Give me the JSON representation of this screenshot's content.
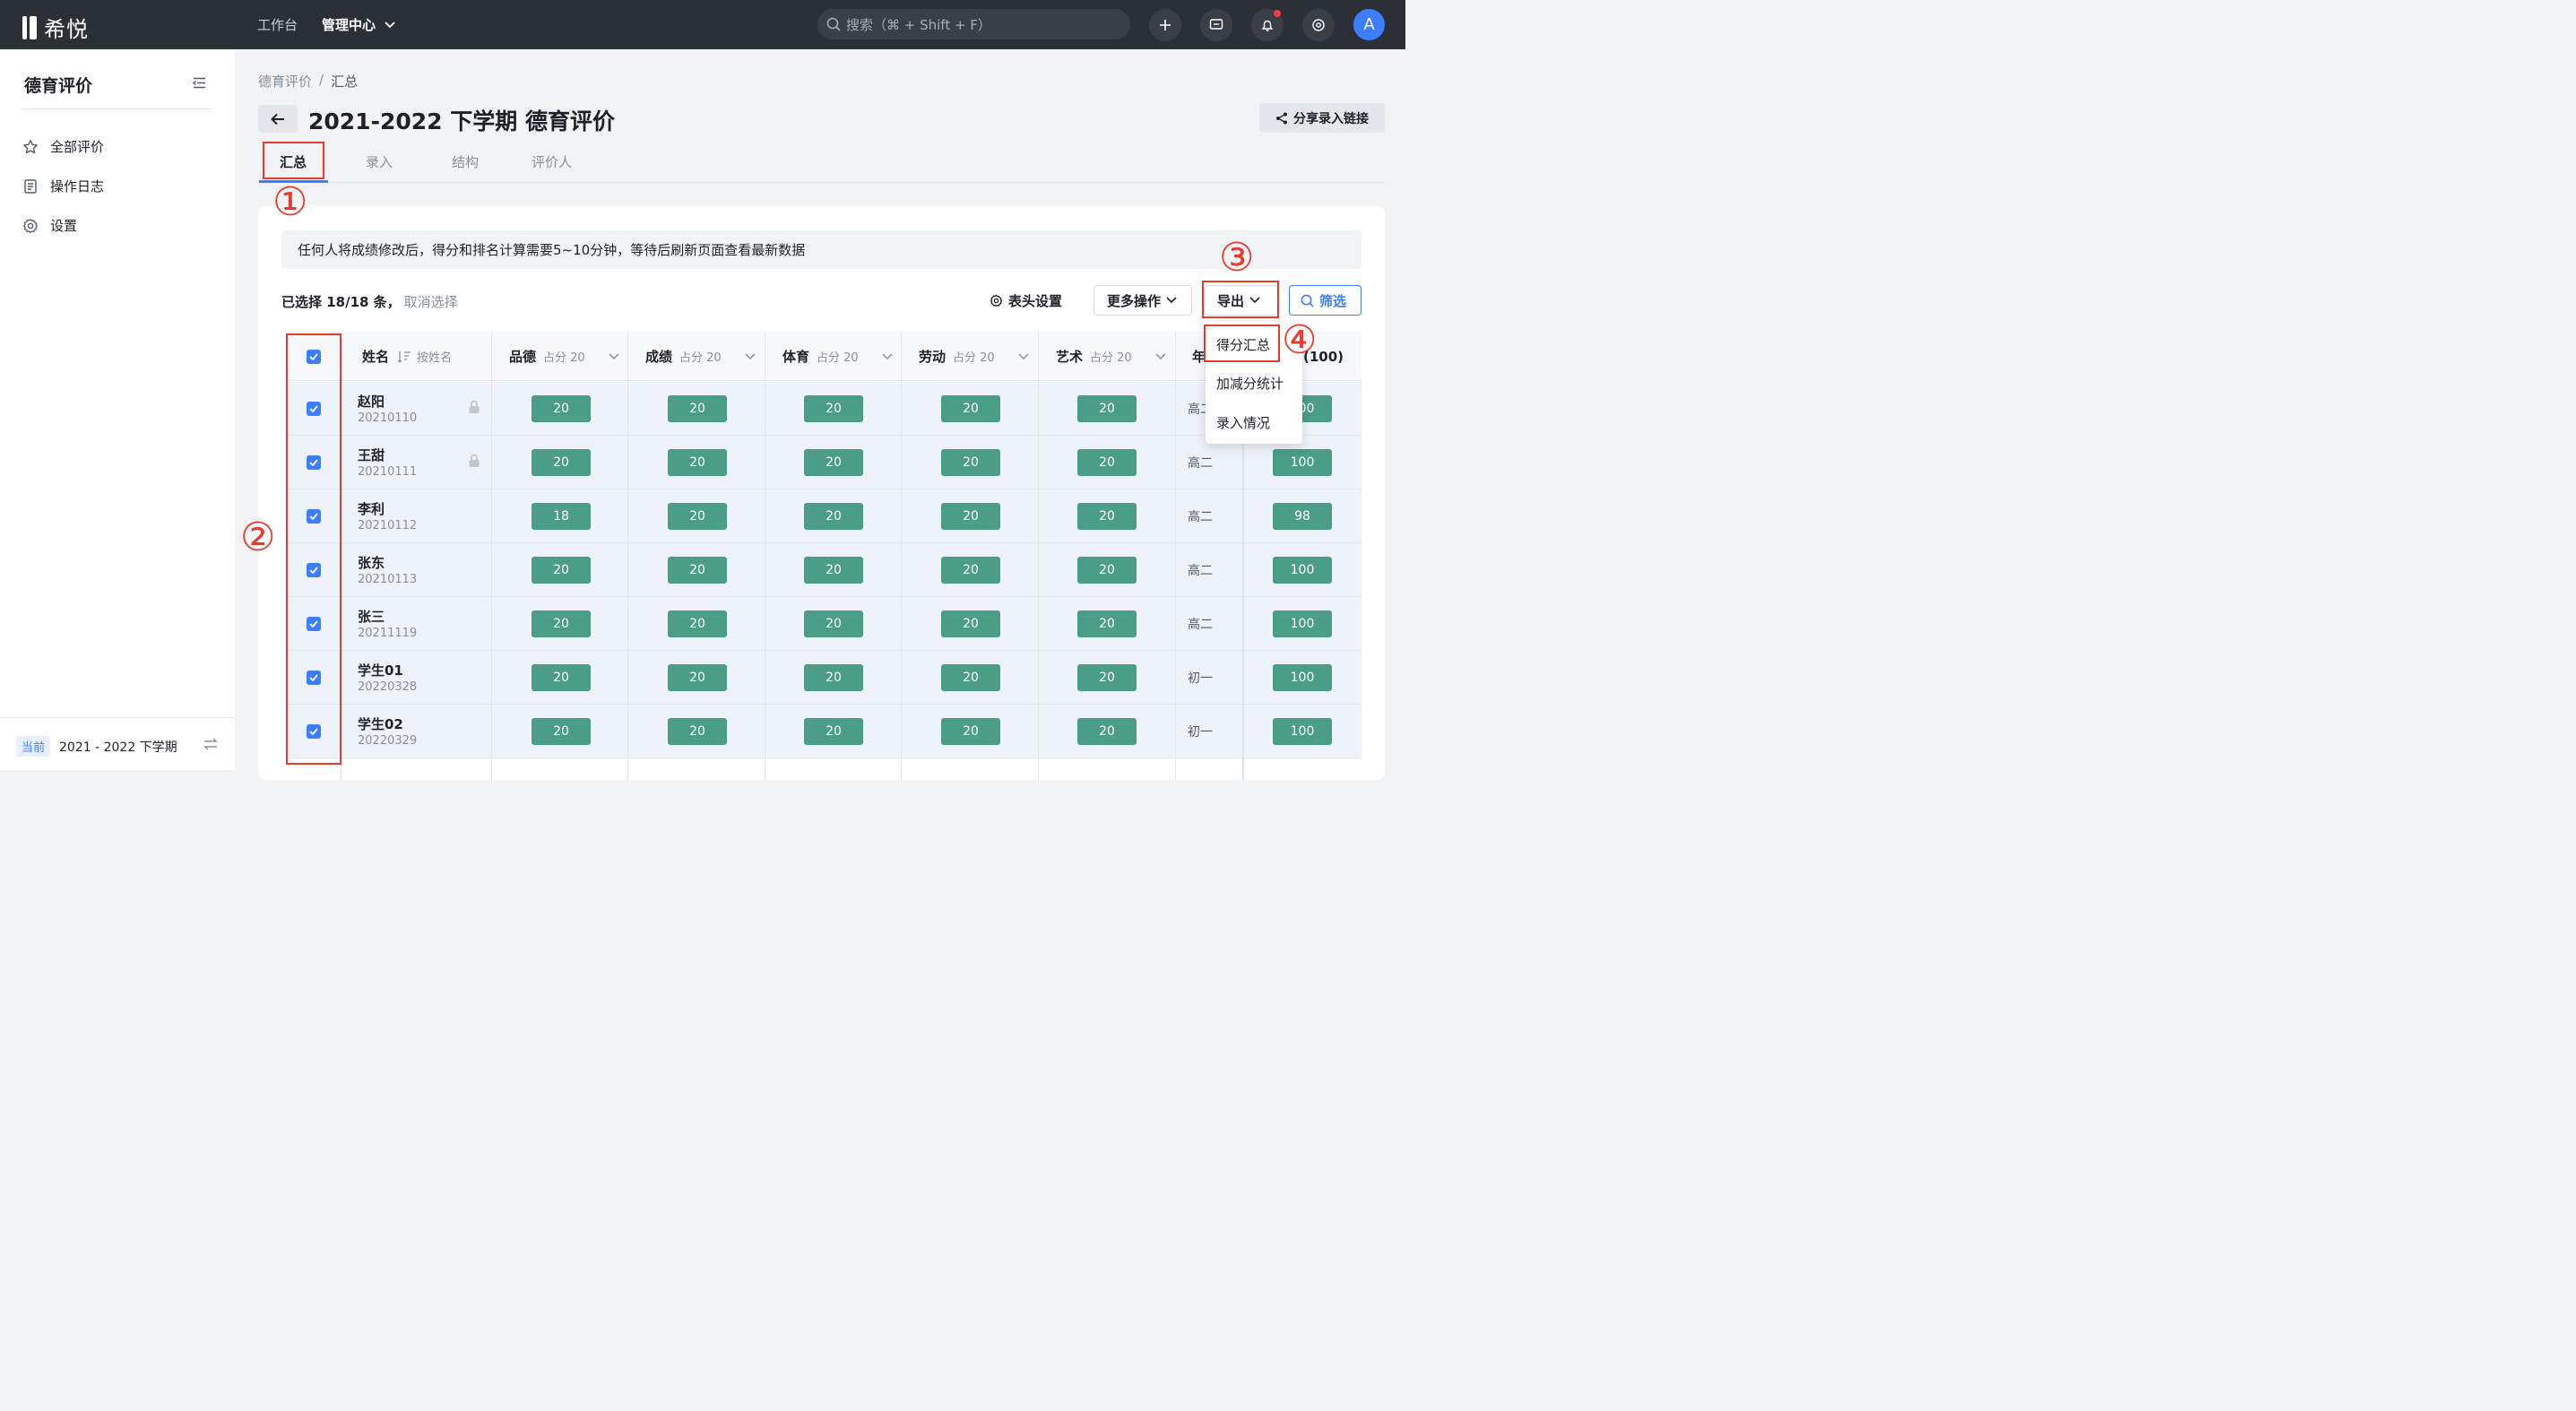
{
  "app": {
    "logo_text": "希悦"
  },
  "topnav": {
    "workbench": "工作台",
    "admin_center": "管理中心"
  },
  "search": {
    "placeholder": "搜索（⌘ + Shift + F）"
  },
  "user": {
    "avatar_letter": "A"
  },
  "sidebar": {
    "title": "德育评价",
    "items": [
      {
        "label": "全部评价",
        "icon": "star-icon"
      },
      {
        "label": "操作日志",
        "icon": "document-icon"
      },
      {
        "label": "设置",
        "icon": "gear-icon"
      }
    ],
    "term_badge": "当前",
    "term_label": "2021 - 2022 下学期"
  },
  "breadcrumb": {
    "parent": "德育评价",
    "separator": "/",
    "current": "汇总"
  },
  "page": {
    "title": "2021-2022 下学期 德育评价",
    "share_button": "分享录入链接"
  },
  "tabs": [
    {
      "label": "汇总",
      "active": true
    },
    {
      "label": "录入",
      "active": false
    },
    {
      "label": "结构",
      "active": false
    },
    {
      "label": "评价人",
      "active": false
    }
  ],
  "notice": "任何人将成绩修改后，得分和排名计算需要5~10分钟，等待后刷新页面查看最新数据",
  "toolbar": {
    "selected": "已选择 18/18 条，",
    "cancel": "取消选择",
    "header_settings": "表头设置",
    "more_actions": "更多操作",
    "export": "导出",
    "filter": "筛选"
  },
  "export_menu": [
    "得分汇总",
    "加减分统计",
    "录入情况"
  ],
  "table": {
    "name_header": "姓名",
    "sort_label": "按姓名",
    "columns": [
      {
        "label": "品德",
        "weight": "占分 20"
      },
      {
        "label": "成绩",
        "weight": "占分 20"
      },
      {
        "label": "体育",
        "weight": "占分 20"
      },
      {
        "label": "劳动",
        "weight": "占分 20"
      },
      {
        "label": "艺术",
        "weight": "占分 20"
      }
    ],
    "grade_header_partial": "年",
    "total_header_partial": "(100)",
    "rows": [
      {
        "name": "赵阳",
        "id": "20210110",
        "locked": true,
        "scores": [
          "20",
          "20",
          "20",
          "20",
          "20"
        ],
        "grade": "高二",
        "total": "100"
      },
      {
        "name": "王甜",
        "id": "20210111",
        "locked": true,
        "scores": [
          "20",
          "20",
          "20",
          "20",
          "20"
        ],
        "grade": "高二",
        "total": "100"
      },
      {
        "name": "李利",
        "id": "20210112",
        "locked": false,
        "scores": [
          "18",
          "20",
          "20",
          "20",
          "20"
        ],
        "grade": "高二",
        "total": "98"
      },
      {
        "name": "张东",
        "id": "20210113",
        "locked": false,
        "scores": [
          "20",
          "20",
          "20",
          "20",
          "20"
        ],
        "grade": "高二",
        "total": "100"
      },
      {
        "name": "张三",
        "id": "20211119",
        "locked": false,
        "scores": [
          "20",
          "20",
          "20",
          "20",
          "20"
        ],
        "grade": "高二",
        "total": "100"
      },
      {
        "name": "学生01",
        "id": "20220328",
        "locked": false,
        "scores": [
          "20",
          "20",
          "20",
          "20",
          "20"
        ],
        "grade": "初一",
        "total": "100"
      },
      {
        "name": "学生02",
        "id": "20220329",
        "locked": false,
        "scores": [
          "20",
          "20",
          "20",
          "20",
          "20"
        ],
        "grade": "初一",
        "total": "100"
      }
    ]
  },
  "annotations": [
    "①",
    "②",
    "③",
    "④"
  ],
  "colors": {
    "accent": "#3c7eff",
    "score_badge": "#4a9e86",
    "annotation": "#e53c2e",
    "topbar": "#2b2f36"
  }
}
